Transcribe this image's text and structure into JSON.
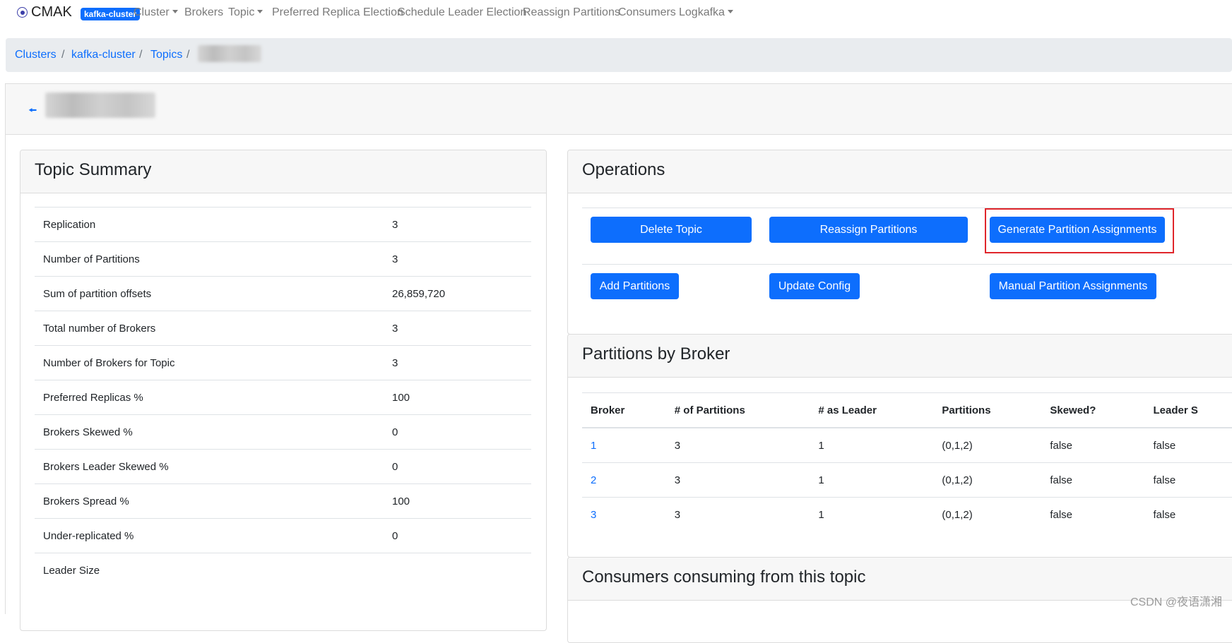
{
  "navbar": {
    "brand": "CMAK",
    "brand_icon": "radio-button-icon",
    "cluster_badge": "kafka-cluster",
    "items": [
      {
        "label": "Cluster",
        "dropdown": true
      },
      {
        "label": "Brokers",
        "dropdown": false
      },
      {
        "label": "Topic",
        "dropdown": true
      },
      {
        "label": "Preferred Replica Election",
        "dropdown": false
      },
      {
        "label": "Schedule Leader Election",
        "dropdown": false
      },
      {
        "label": "Reassign Partitions",
        "dropdown": false
      },
      {
        "label": "Consumers",
        "dropdown": false
      },
      {
        "label": "Logkafka",
        "dropdown": true
      }
    ]
  },
  "breadcrumb": {
    "items": [
      "Clusters",
      "kafka-cluster",
      "Topics"
    ],
    "separator": "/"
  },
  "topic_header": {
    "back_icon": "back-arrow-icon"
  },
  "summary": {
    "title": "Topic Summary",
    "rows": [
      {
        "label": "Replication",
        "value": "3"
      },
      {
        "label": "Number of Partitions",
        "value": "3"
      },
      {
        "label": "Sum of partition offsets",
        "value": "26,859,720"
      },
      {
        "label": "Total number of Brokers",
        "value": "3"
      },
      {
        "label": "Number of Brokers for Topic",
        "value": "3"
      },
      {
        "label": "Preferred Replicas %",
        "value": "100"
      },
      {
        "label": "Brokers Skewed %",
        "value": "0"
      },
      {
        "label": "Brokers Leader Skewed %",
        "value": "0"
      },
      {
        "label": "Brokers Spread %",
        "value": "100"
      },
      {
        "label": "Under-replicated %",
        "value": "0"
      },
      {
        "label": "Leader Size",
        "value": ""
      }
    ]
  },
  "operations": {
    "title": "Operations",
    "buttons": {
      "delete_topic": "Delete Topic",
      "reassign_partitions": "Reassign Partitions",
      "generate_assignments": "Generate Partition Assignments",
      "add_partitions": "Add Partitions",
      "update_config": "Update Config",
      "manual_assignments": "Manual Partition Assignments"
    },
    "highlight_color": "#e0262b"
  },
  "partitions_by_broker": {
    "title": "Partitions by Broker",
    "columns": [
      "Broker",
      "# of Partitions",
      "# as Leader",
      "Partitions",
      "Skewed?",
      "Leader S"
    ],
    "rows": [
      [
        "1",
        "3",
        "1",
        "(0,1,2)",
        "false",
        "false"
      ],
      [
        "2",
        "3",
        "1",
        "(0,1,2)",
        "false",
        "false"
      ],
      [
        "3",
        "3",
        "1",
        "(0,1,2)",
        "false",
        "false"
      ]
    ]
  },
  "consumers": {
    "title": "Consumers consuming from this topic"
  },
  "watermark": "CSDN @夜语潇湘",
  "colors": {
    "primary": "#0d6efd",
    "breadcrumb_bg": "#e9ecef",
    "card_header_bg": "#f7f7f7"
  }
}
